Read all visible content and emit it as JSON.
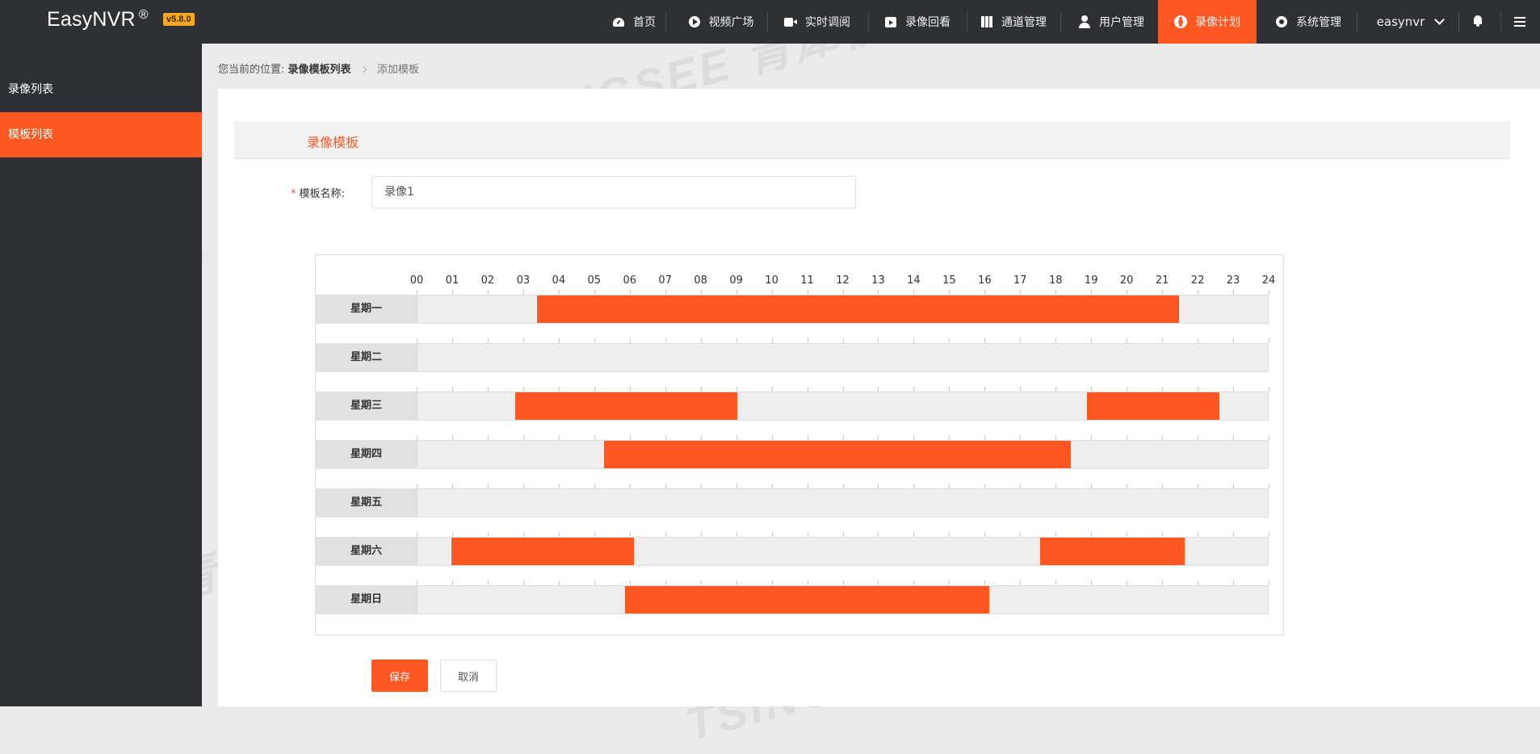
{
  "app": {
    "name": "EasyNVR",
    "registered": "®",
    "version": "v5.8.0"
  },
  "nav": [
    {
      "label": "首页",
      "icon": "home-icon"
    },
    {
      "label": "视频广场",
      "icon": "play-icon"
    },
    {
      "label": "实时调阅",
      "icon": "video-icon"
    },
    {
      "label": "录像回看",
      "icon": "replay-icon"
    },
    {
      "label": "通道管理",
      "icon": "channel-icon"
    },
    {
      "label": "用户管理",
      "icon": "user-icon"
    },
    {
      "label": "录像计划",
      "icon": "plan-icon",
      "active": true
    },
    {
      "label": "系统管理",
      "icon": "gear-icon"
    }
  ],
  "user": {
    "name": "easynvr"
  },
  "sidebar": {
    "items": [
      {
        "label": "录像列表"
      },
      {
        "label": "模板列表",
        "active": true
      }
    ]
  },
  "breadcrumb": {
    "prefix": "您当前的位置:",
    "parent": "录像模板列表",
    "current": "添加模板"
  },
  "section": {
    "title": "录像模板"
  },
  "form": {
    "name_label": "模板名称:",
    "required": "*",
    "name_value": "录像1"
  },
  "schedule": {
    "hours": [
      "00",
      "01",
      "02",
      "03",
      "04",
      "05",
      "06",
      "07",
      "08",
      "09",
      "10",
      "11",
      "12",
      "13",
      "14",
      "15",
      "16",
      "17",
      "18",
      "19",
      "20",
      "21",
      "22",
      "23",
      "24"
    ],
    "days": [
      {
        "label": "星期一",
        "ranges": [
          [
            3.37,
            21.45
          ]
        ]
      },
      {
        "label": "星期二",
        "ranges": []
      },
      {
        "label": "星期三",
        "ranges": [
          [
            2.75,
            9.0
          ],
          [
            18.85,
            22.6
          ]
        ]
      },
      {
        "label": "星期四",
        "ranges": [
          [
            5.25,
            18.4
          ]
        ]
      },
      {
        "label": "星期五",
        "ranges": []
      },
      {
        "label": "星期六",
        "ranges": [
          [
            0.95,
            6.1
          ],
          [
            17.55,
            21.6
          ]
        ]
      },
      {
        "label": "星期日",
        "ranges": [
          [
            5.85,
            16.1
          ]
        ]
      }
    ]
  },
  "buttons": {
    "save": "保存",
    "cancel": "取消"
  },
  "watermark": "TSINGSEE 青犀视频",
  "colors": {
    "accent": "#ff5722",
    "topbar": "#2e3033",
    "version_badge": "#f5a623"
  }
}
